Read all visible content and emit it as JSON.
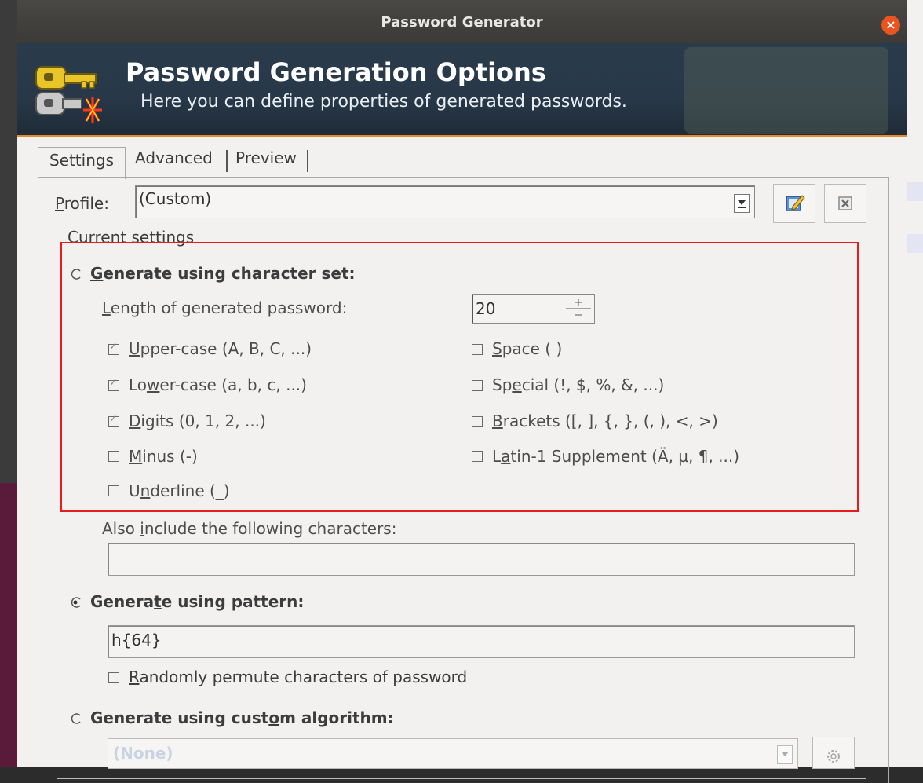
{
  "window": {
    "title": "Password Generator",
    "close_icon": "×"
  },
  "banner": {
    "title": "Password Generation Options",
    "subtitle": "Here you can define properties of generated passwords.",
    "icon": "keys-icon"
  },
  "tabs": [
    {
      "label": "Settings",
      "active": true
    },
    {
      "label": "Advanced",
      "active": false
    },
    {
      "label": "Preview",
      "active": false
    }
  ],
  "profile": {
    "label_u": "P",
    "label_rest": "rofile:",
    "value": "(Custom)"
  },
  "current_settings": {
    "label": "Current settings"
  },
  "charset": {
    "radio_label_u": "G",
    "radio_label_rest": "enerate using character set:",
    "radio_checked": false,
    "length_label_u": "L",
    "length_label_rest": "ength of generated password:",
    "length_value": "20",
    "options_left": [
      {
        "u": "U",
        "rest": "pper-case (A, B, C, ...)",
        "checked": true
      },
      {
        "pre": "Lo",
        "u": "w",
        "rest": "er-case (a, b, c, ...)",
        "checked": true
      },
      {
        "u": "D",
        "rest": "igits (0, 1, 2, ...)",
        "checked": true
      },
      {
        "u": "M",
        "rest": "inus (-)",
        "checked": false
      },
      {
        "pre": "U",
        "u": "n",
        "rest": "derline (_)",
        "checked": false
      }
    ],
    "options_right": [
      {
        "u": "S",
        "rest": "pace ( )",
        "checked": false
      },
      {
        "pre": "Sp",
        "u": "e",
        "rest": "cial (!, $, %, &, ...)",
        "checked": false
      },
      {
        "u": "B",
        "rest": "rackets ([, ], {, }, (, ), <, >)",
        "checked": false
      },
      {
        "pre": "L",
        "u": "a",
        "rest": "tin-1 Supplement (Ä, µ, ¶, ...)",
        "checked": false
      }
    ],
    "also_include_pre": "Also ",
    "also_include_u": "i",
    "also_include_rest": "nclude the following characters:",
    "also_include_value": ""
  },
  "pattern": {
    "radio_label_pre": "Genera",
    "radio_label_u": "t",
    "radio_label_rest": "e using pattern:",
    "radio_checked": true,
    "value": "h{64}",
    "permute_u": "R",
    "permute_rest": "andomly permute characters of password",
    "permute_checked": false
  },
  "custom": {
    "radio_label_pre": "Generate using cust",
    "radio_label_u": "o",
    "radio_label_rest": "m algorithm:",
    "radio_checked": false,
    "value": "(None)"
  }
}
